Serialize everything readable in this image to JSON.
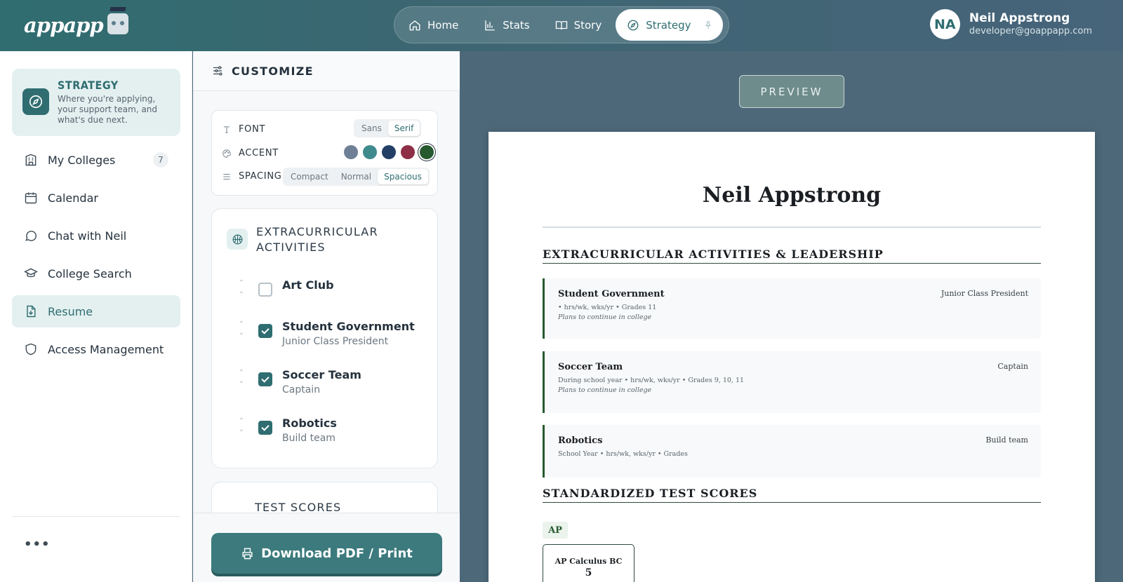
{
  "header": {
    "logo_text": "appapp",
    "nav": [
      {
        "label": "Home",
        "icon": "home-icon"
      },
      {
        "label": "Stats",
        "icon": "chart-icon"
      },
      {
        "label": "Story",
        "icon": "book-icon"
      },
      {
        "label": "Strategy",
        "icon": "compass-icon",
        "active": true
      }
    ],
    "user": {
      "initials": "NA",
      "name": "Neil Appstrong",
      "email": "developer@goappapp.com"
    }
  },
  "sidebar": {
    "strategy": {
      "title": "STRATEGY",
      "description": "Where you're applying, your support team, and what's due next."
    },
    "items": [
      {
        "label": "My Colleges",
        "badge": "7"
      },
      {
        "label": "Calendar"
      },
      {
        "label": "Chat with Neil"
      },
      {
        "label": "College Search"
      },
      {
        "label": "Resume",
        "active": true
      },
      {
        "label": "Access Management"
      }
    ],
    "more": "•••"
  },
  "customize": {
    "title": "CUSTOMIZE",
    "font": {
      "label": "FONT",
      "options": [
        "Sans",
        "Serif"
      ],
      "selected": "Serif"
    },
    "accent": {
      "label": "ACCENT",
      "colors": [
        "#6f7f96",
        "#3f8a8c",
        "#233f66",
        "#8e2f45",
        "#27592f"
      ],
      "selected": "#27592f"
    },
    "spacing": {
      "label": "SPACING",
      "options": [
        "Compact",
        "Normal",
        "Spacious"
      ],
      "selected": "Spacious"
    },
    "extracurricular": {
      "title_line1": "EXTRACURRICULAR",
      "title_line2": "ACTIVITIES",
      "items": [
        {
          "name": "Art Club",
          "role": "",
          "checked": false
        },
        {
          "name": "Student Government",
          "role": "Junior Class President",
          "checked": true
        },
        {
          "name": "Soccer Team",
          "role": "Captain",
          "checked": true
        },
        {
          "name": "Robotics",
          "role": "Build team",
          "checked": true
        }
      ]
    },
    "next_section": "TEST SCORES",
    "download_label": "Download PDF / Print"
  },
  "preview": {
    "button_label": "PREVIEW",
    "name": "Neil Appstrong",
    "section_activities": "EXTRACURRICULAR ACTIVITIES & LEADERSHIP",
    "entries": [
      {
        "title": "Student Government",
        "role": "Junior Class President",
        "meta": "• hrs/wk, wks/yr • Grades 11",
        "note": "Plans to continue in college"
      },
      {
        "title": "Soccer Team",
        "role": "Captain",
        "meta": "During school year • hrs/wk, wks/yr • Grades 9, 10, 11",
        "note": "Plans to continue in college"
      },
      {
        "title": "Robotics",
        "role": "Build team",
        "meta": "School Year • hrs/wk, wks/yr • Grades",
        "note": ""
      }
    ],
    "section_tests": "STANDARDIZED TEST SCORES",
    "test_tag": "AP",
    "test": {
      "name": "AP Calculus BC",
      "score": "5"
    }
  }
}
